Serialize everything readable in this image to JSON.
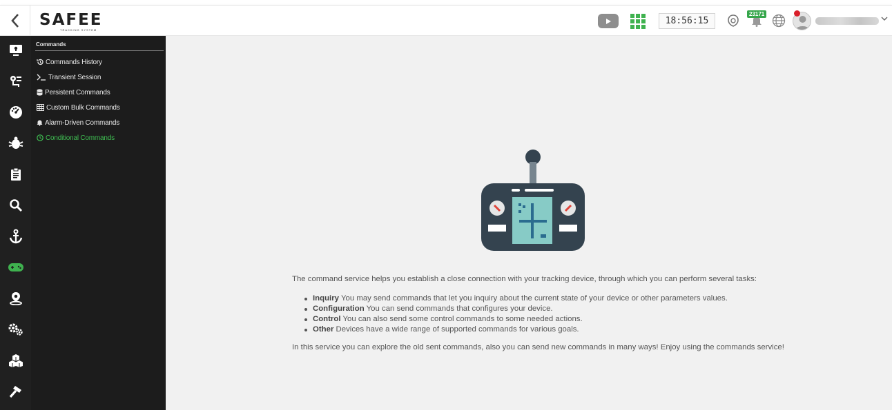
{
  "header": {
    "logo_text": "SAFEE",
    "logo_subtitle": "TRACKING SYSTEM",
    "clock": "18:56:15",
    "notification_count": "23171",
    "accent_color": "#3fb24f",
    "icons": [
      "back-icon",
      "youtube-icon",
      "apps-grid-icon",
      "support-icon",
      "bell-icon",
      "globe-icon",
      "user-avatar",
      "chevron-down-icon"
    ]
  },
  "sidebar": {
    "icons": [
      "monitor-icon",
      "route-icon",
      "dashboard-icon",
      "bug-icon",
      "report-icon",
      "search-icon",
      "anchor-icon",
      "gamepad-icon",
      "location-user-icon",
      "settings-icon",
      "cubes-icon",
      "hammer-icon"
    ],
    "active_icon": "gamepad-icon"
  },
  "submenu": {
    "title": "Commands",
    "items": [
      {
        "label": "Commands History",
        "icon": "history-icon"
      },
      {
        "label": "Transient Session",
        "icon": "terminal-icon"
      },
      {
        "label": "Persistent Commands",
        "icon": "database-icon"
      },
      {
        "label": "Custom Bulk Commands",
        "icon": "table-icon"
      },
      {
        "label": "Alarm-Driven Commands",
        "icon": "bell-icon"
      },
      {
        "label": "Conditional Commands",
        "icon": "clock-icon",
        "active": true
      }
    ]
  },
  "content": {
    "intro": "The command service helps you establish a close connection with your tracking device, through which you can perform several tasks:",
    "tasks": [
      {
        "term": "Inquiry",
        "text": " You may send commands that let you inquiry about the current state of your device or other parameters values."
      },
      {
        "term": "Configuration",
        "text": " You can send commands that configures your device."
      },
      {
        "term": "Control",
        "text": " You can also send some control commands to some needed actions."
      },
      {
        "term": "Other",
        "text": " Devices have a wide range of supported commands for various goals."
      }
    ],
    "outro": "In this service you can explore the old sent commands, also you can send new commands in many ways! Enjoy using the commands service!"
  }
}
